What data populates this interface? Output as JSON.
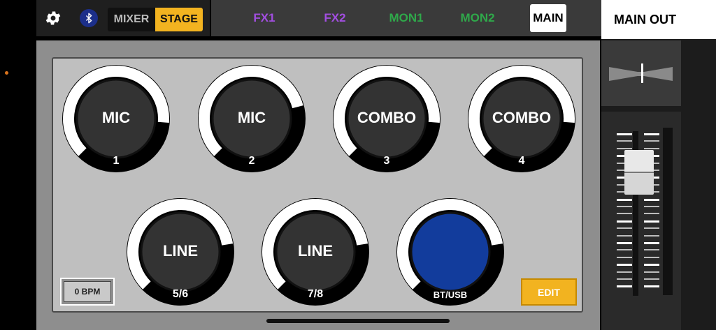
{
  "topbar": {
    "mode_tabs": [
      {
        "label": "MIXER",
        "active": false
      },
      {
        "label": "STAGE",
        "active": true
      }
    ],
    "bus_tabs": [
      {
        "label": "FX1",
        "color": "#a24ee0"
      },
      {
        "label": "FX2",
        "color": "#a24ee0"
      },
      {
        "label": "MON1",
        "color": "#2fa84a"
      },
      {
        "label": "MON2",
        "color": "#2fa84a"
      },
      {
        "label": "MAIN",
        "color": "#000000",
        "active": true
      }
    ],
    "output_title": "MAIN OUT"
  },
  "channels": [
    {
      "name": "MIC",
      "number": "1",
      "level": 0.85
    },
    {
      "name": "MIC",
      "number": "2",
      "level": 0.78
    },
    {
      "name": "COMBO",
      "number": "3",
      "level": 0.85
    },
    {
      "name": "COMBO",
      "number": "4",
      "level": 0.85
    },
    {
      "name": "LINE",
      "number": "5/6",
      "level": 0.8
    },
    {
      "name": "LINE",
      "number": "7/8",
      "level": 0.8
    },
    {
      "name": "",
      "number": "BT/USB",
      "level": 0.8,
      "color": "#123c9c"
    }
  ],
  "bpm": {
    "label": "0 BPM"
  },
  "edit": {
    "label": "EDIT"
  },
  "main_out": {
    "pan": 0.52,
    "fader_level": 0.75
  },
  "colors": {
    "accent": "#f2b320",
    "bluetooth": "#1c2f8a"
  }
}
